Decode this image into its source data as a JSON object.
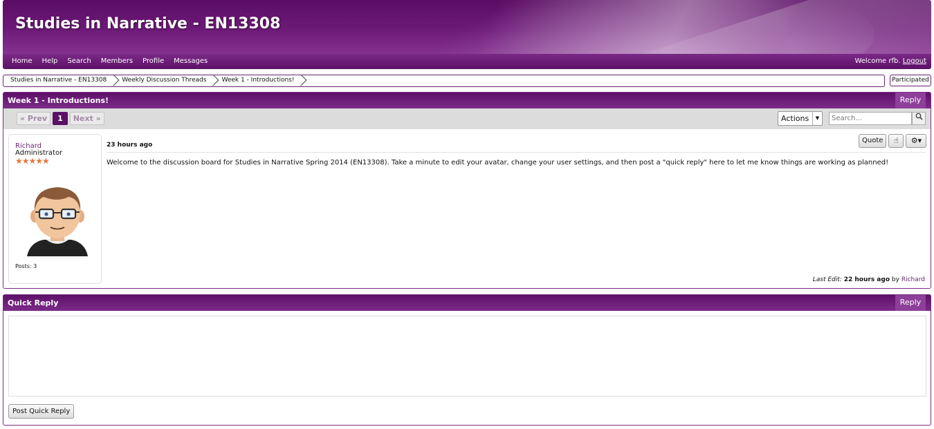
{
  "header": {
    "site_title": "Studies in Narrative - EN13308"
  },
  "nav": {
    "links": [
      "Home",
      "Help",
      "Search",
      "Members",
      "Profile",
      "Messages"
    ],
    "welcome": "Welcome rfb.",
    "logout": "Logout"
  },
  "breadcrumb": {
    "items": [
      "Studies in Narrative - EN13308",
      "Weekly Discussion Threads",
      "Week 1 - Introductions!"
    ],
    "participated": "Participated"
  },
  "thread": {
    "title": "Week 1 - Introductions!",
    "reply_label": "Reply",
    "pager": {
      "prev": "« Prev",
      "current": "1",
      "next": "Next »"
    },
    "actions_label": "Actions",
    "search_placeholder": "Search...",
    "post": {
      "author": "Richard",
      "role": "Administrator",
      "stars": "★★★★★",
      "posts_count": "Posts: 3",
      "date": "23 hours ago",
      "quote_label": "Quote",
      "body": "Welcome to the discussion board for Studies in Narrative Spring 2014 (EN13308). Take a minute to edit your avatar, change your user settings, and then post a \"quick reply\" here to let me know things are working as planned!",
      "last_edit_prefix": "Last Edit:",
      "last_edit_time": "22 hours ago",
      "last_edit_by": "by",
      "last_edit_user": "Richard"
    }
  },
  "quick_reply": {
    "title": "Quick Reply",
    "reply_label": "Reply",
    "post_button": "Post Quick Reply"
  },
  "colors": {
    "brand_purple": "#5e1168",
    "accent_purple": "#8d3f99",
    "link_purple": "#6b2275",
    "star_orange": "#e8743b"
  }
}
